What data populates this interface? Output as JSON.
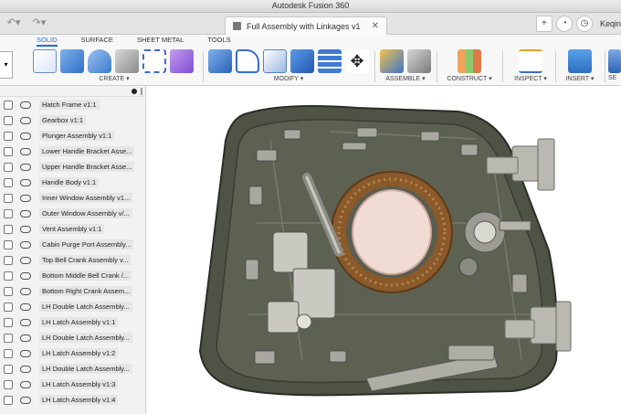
{
  "window": {
    "title": "Autodesk Fusion 360"
  },
  "document_tab": {
    "label": "Full Assembly with Linkages v1",
    "close": "✕"
  },
  "user": {
    "name": "Keqin"
  },
  "workspace_tabs": [
    "SOLID",
    "SURFACE",
    "SHEET METAL",
    "TOOLS"
  ],
  "toolbar_groups": {
    "create": "CREATE ▾",
    "modify": "MODIFY ▾",
    "assemble": "ASSEMBLE ▾",
    "construct": "CONSTRUCT ▾",
    "inspect": "INSPECT ▾",
    "insert": "INSERT ▾",
    "select": "SE"
  },
  "browser_items": [
    "Hatch Frame v1:1",
    "Gearbox v1:1",
    "Plunger Assembly v1:1",
    "Lower Handle Bracket Asse...",
    "Upper Handle Bracket Asse...",
    "Handle Body v1:1",
    "Inner Window Assembly v1...",
    "Outer Window Assembly v/...",
    "Vent Assembly v1:1",
    "Cabin Purge Port Assembly...",
    "Top Bell Crank Assembly v...",
    "Bottom Middle Bell Crank /...",
    "Bottom Right Crank Assem...",
    "LH Double Latch Assembly...",
    "LH Latch Assembly v1:1",
    "LH Double Latch Assembly...",
    "LH Latch Assembly v1:2",
    "LH Double Latch Assembly...",
    "LH Latch Assembly v1:3",
    "LH Latch Assembly v1:4"
  ],
  "colors": {
    "accent": "#1a6fd0",
    "hatch_body": "#4f5346",
    "ring": "#8a5a2b",
    "window": "#f1dcd4"
  }
}
